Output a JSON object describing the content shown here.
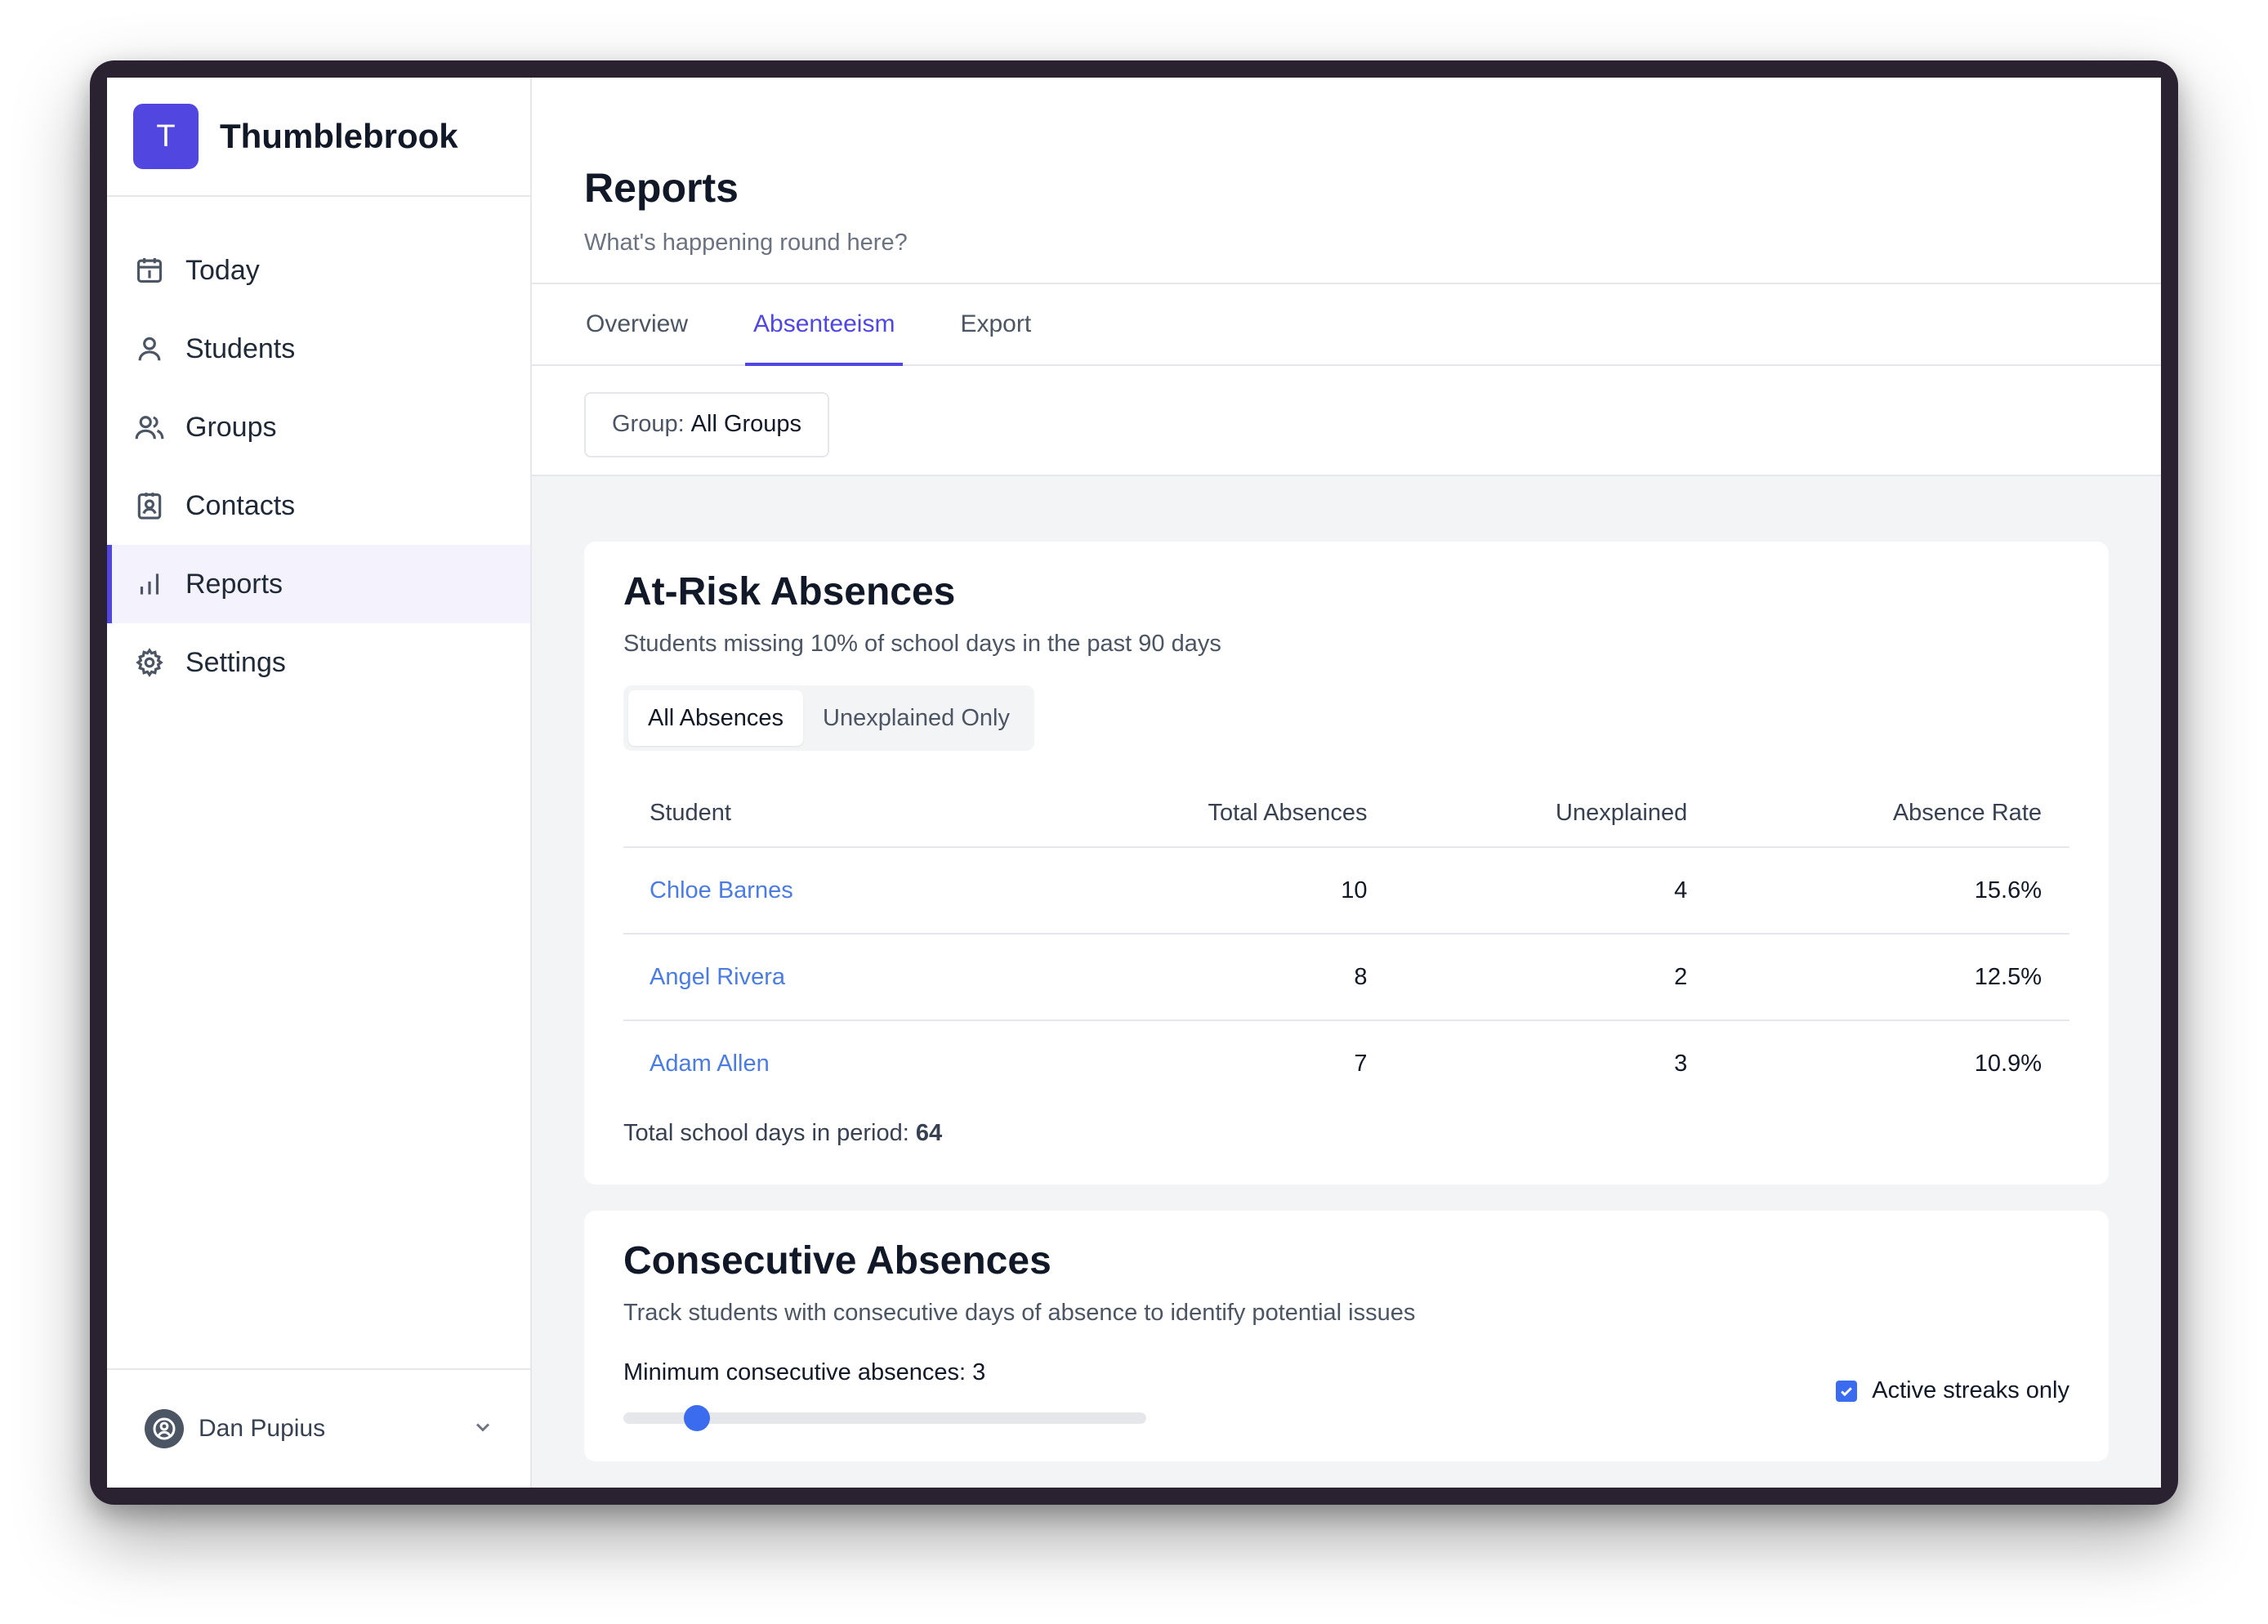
{
  "app": {
    "logo_letter": "T",
    "name": "Thumblebrook",
    "accent": "#5147e0"
  },
  "sidebar": {
    "items": [
      {
        "label": "Today",
        "icon": "calendar-icon"
      },
      {
        "label": "Students",
        "icon": "user-icon"
      },
      {
        "label": "Groups",
        "icon": "users-icon"
      },
      {
        "label": "Contacts",
        "icon": "contact-card-icon"
      },
      {
        "label": "Reports",
        "icon": "bar-chart-icon",
        "active": true
      },
      {
        "label": "Settings",
        "icon": "gear-icon"
      }
    ],
    "user": {
      "name": "Dan Pupius",
      "icon": "user-circle-icon"
    }
  },
  "header": {
    "title": "Reports",
    "subtitle": "What's happening round here?"
  },
  "tabs": [
    {
      "label": "Overview"
    },
    {
      "label": "Absenteeism",
      "active": true
    },
    {
      "label": "Export"
    }
  ],
  "filter": {
    "label": "Group:",
    "value": "All Groups"
  },
  "at_risk": {
    "title": "At-Risk Absences",
    "description": "Students missing 10% of school days in the past 90 days",
    "segments": [
      {
        "label": "All Absences",
        "active": true
      },
      {
        "label": "Unexplained Only"
      }
    ],
    "columns": [
      "Student",
      "Total Absences",
      "Unexplained",
      "Absence Rate"
    ],
    "rows": [
      {
        "student": "Chloe Barnes",
        "total": "10",
        "unexplained": "4",
        "rate": "15.6%"
      },
      {
        "student": "Angel Rivera",
        "total": "8",
        "unexplained": "2",
        "rate": "12.5%"
      },
      {
        "student": "Adam Allen",
        "total": "7",
        "unexplained": "3",
        "rate": "10.9%"
      }
    ],
    "total_label": "Total school days in period:",
    "total_value": "64"
  },
  "consecutive": {
    "title": "Consecutive Absences",
    "description": "Track students with consecutive days of absence to identify potential issues",
    "slider_label": "Minimum consecutive absences: 3",
    "slider_value_fraction": 0.14,
    "checkbox_label": "Active streaks only",
    "checkbox_checked": true
  }
}
